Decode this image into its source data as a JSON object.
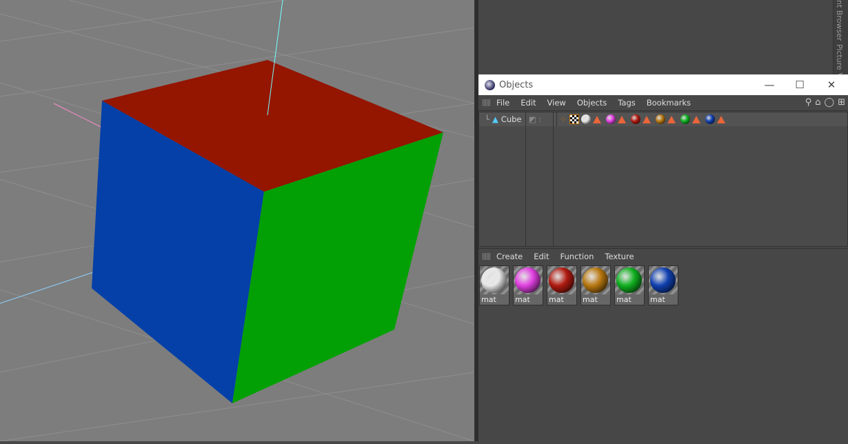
{
  "side_tabs": [
    "nt Browser",
    "Picture V"
  ],
  "objects_window": {
    "title": "Objects",
    "controls": {
      "minimize": "—",
      "maximize": "☐",
      "close": "✕"
    },
    "menu": [
      "File",
      "Edit",
      "View",
      "Objects",
      "Tags",
      "Bookmarks"
    ],
    "objects": [
      {
        "name": "Cube",
        "tags": [
          "#e8e8e8",
          "#e040e0",
          "#b01a10",
          "#b87810",
          "#10b020",
          "#1040b0"
        ]
      }
    ]
  },
  "material_manager": {
    "menu": [
      "Create",
      "Edit",
      "Function",
      "Texture"
    ],
    "materials": [
      {
        "name": "mat",
        "color": "#e8e8e8"
      },
      {
        "name": "mat",
        "color": "#e040e0"
      },
      {
        "name": "mat",
        "color": "#b01a10"
      },
      {
        "name": "mat",
        "color": "#b87810"
      },
      {
        "name": "mat",
        "color": "#10b020"
      },
      {
        "name": "mat",
        "color": "#1040b0"
      }
    ]
  },
  "cube_faces": {
    "top": "#941500",
    "left": "#0440a8",
    "right": "#03a005"
  }
}
